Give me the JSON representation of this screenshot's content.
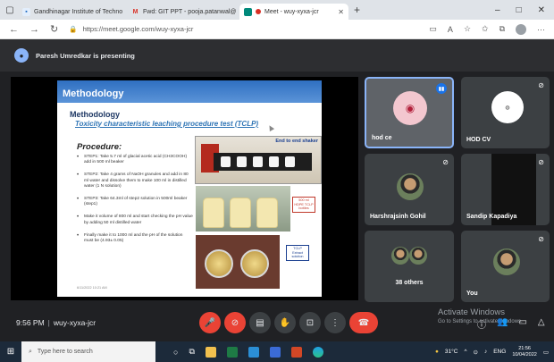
{
  "browser": {
    "tabs": [
      {
        "title": "Gandhinagar Institute of Techno",
        "favicon": "GI",
        "color": "#1565c0"
      },
      {
        "title": "Fwd: GIT PPT - pooja.patanwal@",
        "favicon": "M",
        "color": "#d93025"
      },
      {
        "title": "Meet - wuy-xyxa-jcr",
        "favicon": "Me",
        "color": "#00897b"
      }
    ],
    "new_tab": "+",
    "url": "https://meet.google.com/wuy-xyxa-jcr",
    "window_controls": [
      "–",
      "□",
      "✕"
    ]
  },
  "presenting": {
    "text": "Paresh Umredkar is presenting"
  },
  "slide": {
    "header": "Methodology",
    "title": "Methodology",
    "subtitle": "Toxicity characteristic leaching procedure test (TCLP)",
    "procedure_heading": "Procedure:",
    "steps": [
      "STEP1: Take 5.7 ml of glacial acetic acid (CH3COOH) add in 500 ml beaker",
      "STEP2: Take 4 grams of NaOH granules and add in 80 ml water and dissolve them to make 100 ml in distilled water (1 N solution)",
      "STEP3: Take 64.3ml of step2 solution in 500ml beaker (step1)",
      "Make it volume of 800 ml and start checking the pH value by adding 50 ml distilled water",
      "Finally make it to 1000 ml and the pH of the solution must be (4.93± 0.05)"
    ],
    "photo1_label": "End to end shaker",
    "photo2_label": "500 ml HDPE TCLP bottles",
    "photo3_label": "TCLP Extract solution",
    "date": "6/11/2022 10:21 AM"
  },
  "tiles": [
    {
      "name": "hod ce",
      "status": "speaking"
    },
    {
      "name": "HOD CV",
      "status": "muted"
    },
    {
      "name": "Harshrajsinh Gohil",
      "status": "muted"
    },
    {
      "name": "Sandip Kapadiya",
      "status": "muted"
    },
    {
      "name": "38 others",
      "status": ""
    },
    {
      "name": "You",
      "status": "muted"
    }
  ],
  "bottom": {
    "time": "9:56 PM",
    "meeting_code": "wuy-xyxa-jcr",
    "activate_title": "Activate Windows",
    "activate_sub": "Go to Settings to activate Windows."
  },
  "taskbar": {
    "search_placeholder": "Type here to search",
    "temperature": "31°C",
    "lang": "ENG",
    "time": "21:56",
    "date": "10/04/2022"
  }
}
